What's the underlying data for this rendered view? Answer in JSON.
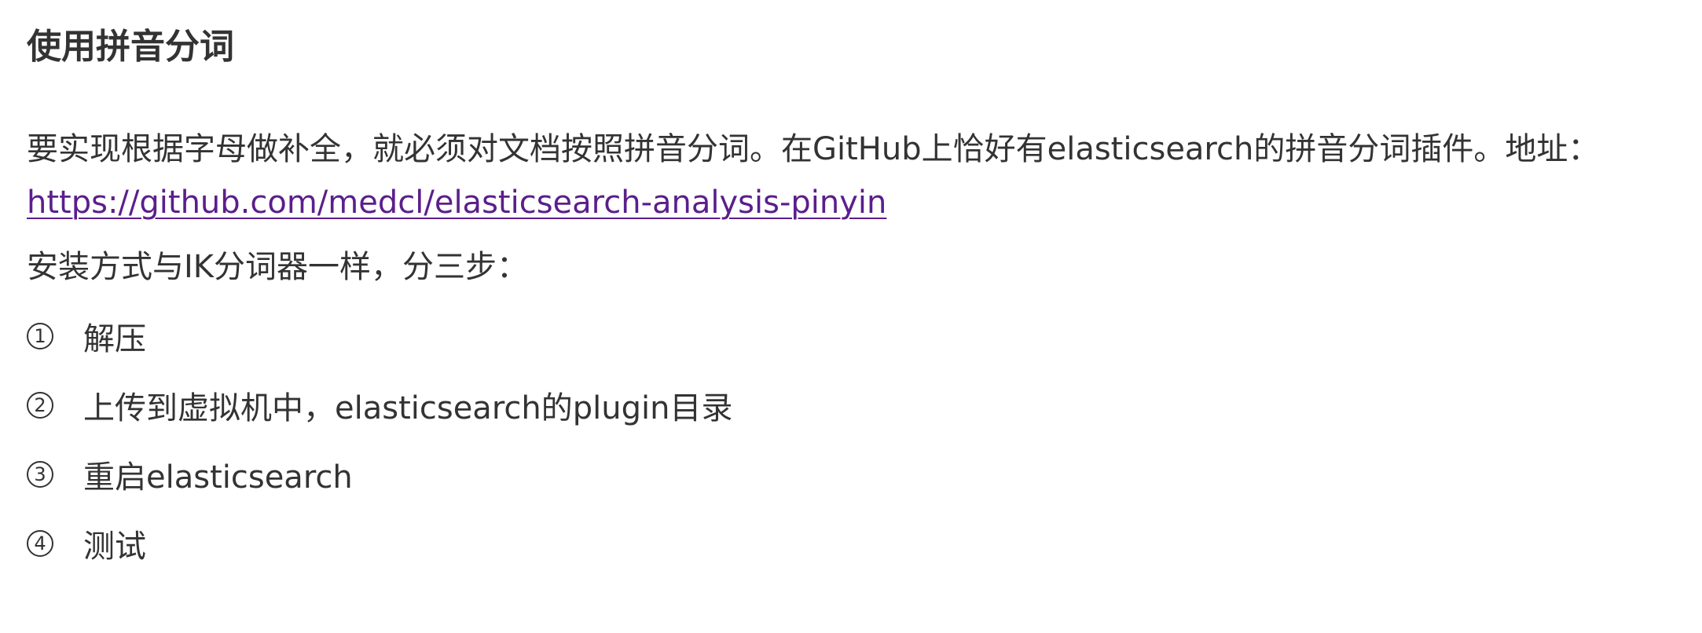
{
  "title": "使用拼音分词",
  "paragraph": {
    "text": "要实现根据字母做补全，就必须对文档按照拼音分词。在GitHub上恰好有elasticsearch的拼音分词插件。地址：",
    "link": "https://github.com/medcl/elasticsearch-analysis-pinyin"
  },
  "intro": "安装方式与IK分词器一样，分三步：",
  "steps": [
    {
      "number": "1",
      "text": "解压"
    },
    {
      "number": "2",
      "text": "上传到虚拟机中，elasticsearch的plugin目录"
    },
    {
      "number": "3",
      "text": "重启elasticsearch"
    },
    {
      "number": "4",
      "text": "测试"
    }
  ]
}
